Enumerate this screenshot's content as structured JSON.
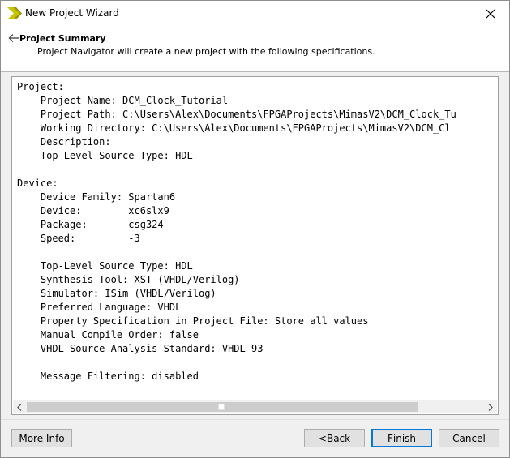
{
  "window": {
    "title": "New Project Wizard"
  },
  "header": {
    "title": "Project Summary",
    "subtitle": "Project Navigator will create a new project with the following specifications."
  },
  "summary_lines": [
    "Project:",
    "    Project Name: DCM_Clock_Tutorial",
    "    Project Path: C:\\Users\\Alex\\Documents\\FPGAProjects\\MimasV2\\DCM_Clock_Tu",
    "    Working Directory: C:\\Users\\Alex\\Documents\\FPGAProjects\\MimasV2\\DCM_Cl",
    "    Description:",
    "    Top Level Source Type: HDL",
    "",
    "Device:",
    "    Device Family: Spartan6",
    "    Device:        xc6slx9",
    "    Package:       csg324",
    "    Speed:         -3",
    "",
    "    Top-Level Source Type: HDL",
    "    Synthesis Tool: XST (VHDL/Verilog)",
    "    Simulator: ISim (VHDL/Verilog)",
    "    Preferred Language: VHDL",
    "    Property Specification in Project File: Store all values",
    "    Manual Compile Order: false",
    "    VHDL Source Analysis Standard: VHDL-93",
    "",
    "    Message Filtering: disabled"
  ],
  "buttons": {
    "more_info": {
      "pre": "",
      "ul": "M",
      "post": "ore Info"
    },
    "back": {
      "pre": "< ",
      "ul": "B",
      "post": "ack"
    },
    "finish": {
      "pre": "",
      "ul": "F",
      "post": "inish"
    },
    "cancel": {
      "pre": "",
      "ul": "",
      "post": "Cancel"
    }
  },
  "icons": {
    "app_logo": "xilinx-logo-icon",
    "close": "close-icon",
    "back": "back-arrow-icon",
    "scroll_left": "scroll-left-arrow-icon",
    "scroll_right": "scroll-right-arrow-icon"
  },
  "colors": {
    "default_button_border": "#0078d7",
    "logo_yellow": "#c8c200"
  }
}
